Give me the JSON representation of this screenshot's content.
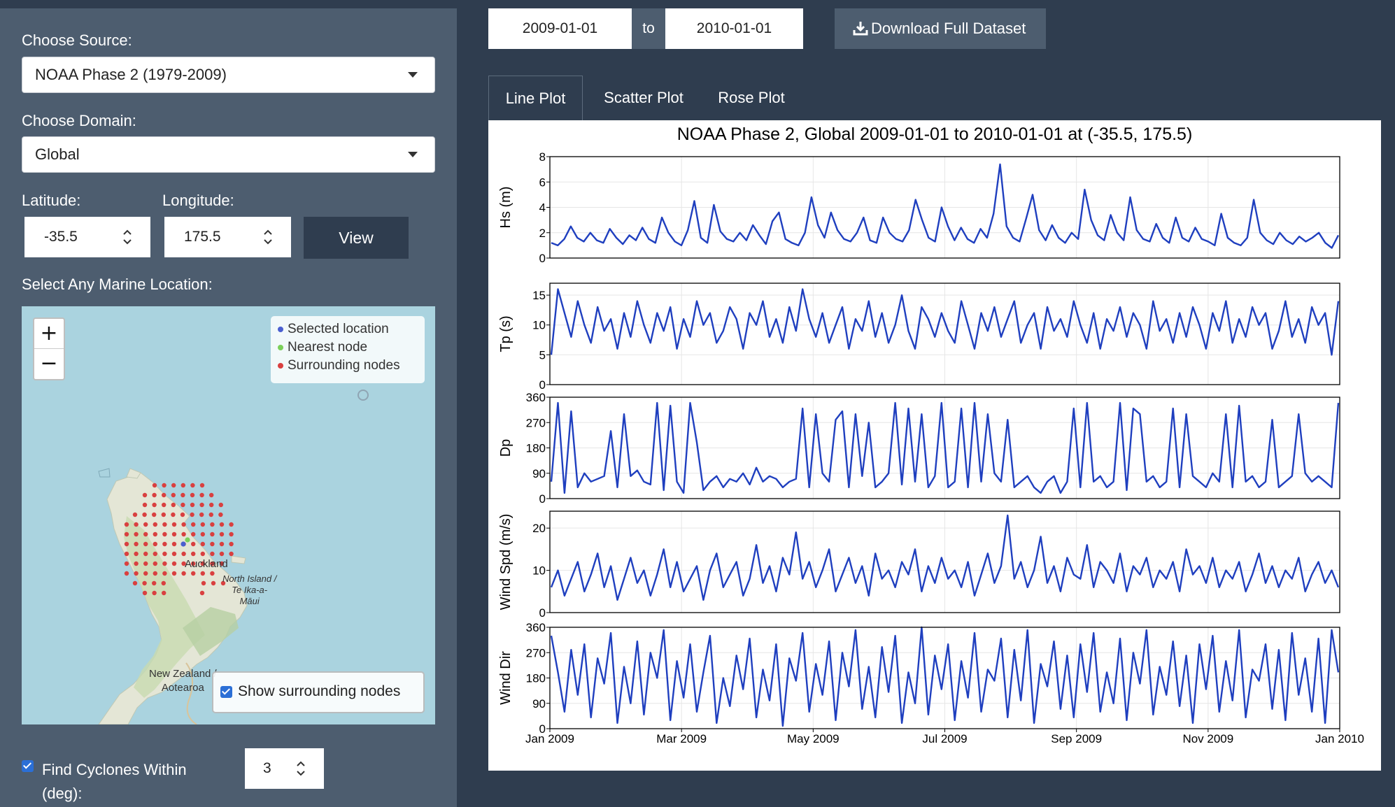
{
  "sidebar": {
    "source_label": "Choose Source:",
    "source_value": "NOAA Phase 2 (1979-2009)",
    "domain_label": "Choose Domain:",
    "domain_value": "Global",
    "latitude_label": "Latitude:",
    "latitude_value": "-35.5",
    "longitude_label": "Longitude:",
    "longitude_value": "175.5",
    "view_button": "View",
    "map_label": "Select Any Marine Location:",
    "cyclone_label_1": "Find Cyclones Within",
    "cyclone_label_2": "(deg):",
    "cyclone_value": "3"
  },
  "map": {
    "zoom_in": "+",
    "zoom_out": "−",
    "legend": [
      {
        "label": "Selected location",
        "color": "#4a5fd0"
      },
      {
        "label": "Nearest node",
        "color": "#7bd05a"
      },
      {
        "label": "Surrounding nodes",
        "color": "#d94040"
      }
    ],
    "place_auckland": "Auckland",
    "place_north_island_1": "North Island /",
    "place_north_island_2": "Te Ika-a-",
    "place_north_island_3": "Māui",
    "place_nz_1": "New Zealand /",
    "place_nz_2": "Aotearoa",
    "show_nodes_label": "Show surrounding nodes"
  },
  "topbar": {
    "start_date": "2009-01-01",
    "to_label": "to",
    "end_date": "2010-01-01",
    "download_label": "Download Full Dataset"
  },
  "tabs": [
    "Line Plot",
    "Scatter Plot",
    "Rose Plot"
  ],
  "chart_data": {
    "type": "line",
    "title": "NOAA Phase 2, Global 2009-01-01 to 2010-01-01 at (-35.5, 175.5)",
    "x_ticks": [
      "Jan 2009",
      "Mar 2009",
      "May 2009",
      "Jul 2009",
      "Sep 2009",
      "Nov 2009",
      "Jan 2010"
    ],
    "color": "#1f3fbf",
    "panels": [
      {
        "ylabel": "Hs (m)",
        "ylim": [
          0,
          8
        ],
        "yticks": [
          0,
          2,
          4,
          6,
          8
        ],
        "values": [
          1.2,
          1.0,
          1.5,
          2.5,
          1.6,
          1.3,
          2.0,
          1.4,
          1.2,
          2.3,
          1.6,
          1.1,
          1.8,
          1.4,
          2.4,
          1.5,
          1.2,
          3.2,
          2.0,
          1.3,
          1.0,
          2.2,
          4.5,
          1.6,
          1.2,
          4.2,
          2.1,
          1.5,
          1.3,
          2.0,
          1.4,
          2.6,
          1.8,
          1.1,
          2.9,
          3.6,
          1.5,
          1.2,
          1.0,
          2.0,
          4.8,
          2.6,
          1.6,
          3.6,
          2.2,
          1.5,
          1.3,
          2.0,
          3.2,
          1.4,
          1.2,
          3.2,
          2.0,
          1.5,
          1.3,
          2.2,
          4.6,
          3.0,
          1.6,
          1.3,
          4.0,
          2.5,
          1.4,
          2.4,
          1.5,
          1.2,
          2.3,
          1.6,
          3.5,
          7.4,
          2.5,
          1.6,
          1.3,
          3.1,
          5.0,
          2.2,
          1.4,
          2.6,
          1.6,
          1.2,
          2.0,
          1.5,
          5.4,
          3.0,
          1.8,
          1.4,
          3.4,
          2.0,
          1.4,
          4.8,
          2.2,
          1.5,
          1.3,
          2.7,
          1.6,
          1.2,
          3.2,
          1.6,
          1.3,
          2.4,
          1.5,
          1.3,
          1.0,
          3.5,
          1.6,
          1.2,
          1.0,
          1.6,
          4.6,
          2.0,
          1.4,
          1.1,
          2.0,
          1.4,
          1.1,
          1.7,
          1.3,
          1.6,
          2.0,
          1.2,
          0.8,
          1.8
        ]
      },
      {
        "ylabel": "Tp (s)",
        "ylim": [
          0,
          17
        ],
        "yticks": [
          0,
          5,
          10,
          15
        ],
        "values": [
          5,
          16,
          12,
          8,
          14,
          10,
          7,
          13,
          9,
          11,
          6,
          12,
          8,
          14,
          10,
          7,
          12,
          9,
          13,
          6,
          11,
          8,
          14,
          10,
          12,
          7,
          9,
          13,
          11,
          6,
          12,
          10,
          14,
          8,
          11,
          7,
          13,
          9,
          16,
          11,
          8,
          12,
          7,
          10,
          13,
          6,
          11,
          9,
          14,
          8,
          12,
          7,
          10,
          15,
          9,
          6,
          13,
          11,
          8,
          12,
          9,
          7,
          14,
          10,
          6,
          12,
          9,
          13,
          8,
          11,
          14,
          7,
          10,
          12,
          6,
          13,
          9,
          11,
          8,
          14,
          10,
          7,
          12,
          6,
          11,
          9,
          13,
          8,
          12,
          10,
          6,
          14,
          9,
          11,
          7,
          12,
          8,
          13,
          10,
          6,
          12,
          9,
          14,
          7,
          11,
          8,
          13,
          10,
          12,
          6,
          9,
          14,
          8,
          11,
          7,
          13,
          10,
          12,
          5,
          14
        ]
      },
      {
        "ylabel": "Dp",
        "ylim": [
          0,
          360
        ],
        "yticks": [
          0,
          90,
          180,
          270,
          360
        ],
        "values": [
          60,
          340,
          20,
          310,
          40,
          90,
          60,
          70,
          80,
          240,
          40,
          300,
          80,
          100,
          60,
          50,
          340,
          30,
          330,
          60,
          20,
          340,
          200,
          30,
          60,
          80,
          40,
          70,
          60,
          90,
          50,
          110,
          60,
          80,
          70,
          40,
          60,
          70,
          320,
          40,
          300,
          90,
          60,
          280,
          310,
          40,
          300,
          80,
          270,
          40,
          60,
          90,
          340,
          50,
          320,
          60,
          300,
          40,
          80,
          340,
          40,
          60,
          320,
          40,
          340,
          60,
          300,
          90,
          60,
          280,
          40,
          60,
          80,
          40,
          20,
          60,
          80,
          20,
          60,
          320,
          40,
          340,
          60,
          80,
          40,
          60,
          340,
          30,
          320,
          300,
          60,
          80,
          40,
          60,
          320,
          40,
          300,
          80,
          60,
          40,
          90,
          60,
          300,
          40,
          330,
          60,
          80,
          40,
          60,
          280,
          40,
          60,
          80,
          300,
          90,
          60,
          80,
          60,
          40,
          340
        ]
      },
      {
        "ylabel": "Wind Spd (m/s)",
        "ylim": [
          0,
          24
        ],
        "yticks": [
          0,
          10,
          20
        ],
        "values": [
          6,
          10,
          4,
          8,
          12,
          5,
          9,
          14,
          6,
          11,
          3,
          8,
          13,
          7,
          10,
          4,
          9,
          15,
          6,
          12,
          5,
          8,
          11,
          3,
          10,
          14,
          6,
          9,
          12,
          4,
          8,
          16,
          7,
          11,
          5,
          13,
          9,
          19,
          8,
          12,
          6,
          10,
          15,
          5,
          9,
          13,
          7,
          11,
          4,
          14,
          8,
          10,
          6,
          12,
          9,
          15,
          5,
          11,
          7,
          13,
          8,
          10,
          6,
          12,
          4,
          9,
          14,
          7,
          11,
          23,
          8,
          12,
          6,
          10,
          18,
          7,
          11,
          5,
          13,
          9,
          8,
          16,
          6,
          12,
          10,
          7,
          14,
          5,
          11,
          9,
          13,
          6,
          10,
          8,
          12,
          5,
          15,
          9,
          11,
          7,
          13,
          6,
          10,
          8,
          12,
          5,
          9,
          14,
          7,
          11,
          6,
          10,
          8,
          13,
          5,
          9,
          12,
          7,
          10,
          6
        ]
      },
      {
        "ylabel": "Wind Dir",
        "ylim": [
          0,
          360
        ],
        "yticks": [
          0,
          90,
          180,
          270,
          360
        ],
        "values": [
          330,
          200,
          60,
          280,
          120,
          300,
          40,
          250,
          160,
          340,
          20,
          220,
          90,
          310,
          50,
          270,
          180,
          350,
          30,
          240,
          110,
          300,
          60,
          200,
          330,
          20,
          180,
          80,
          260,
          140,
          320,
          40,
          210,
          100,
          300,
          10,
          250,
          170,
          340,
          60,
          230,
          120,
          310,
          30,
          270,
          150,
          350,
          70,
          220,
          40,
          290,
          130,
          330,
          20,
          200,
          90,
          360,
          50,
          260,
          140,
          300,
          30,
          240,
          110,
          340,
          60,
          210,
          170,
          320,
          40,
          280,
          100,
          350,
          20,
          230,
          150,
          310,
          70,
          260,
          40,
          300,
          130,
          340,
          60,
          200,
          90,
          320,
          30,
          270,
          160,
          350,
          50,
          220,
          120,
          310,
          80,
          260,
          20,
          300,
          140,
          330,
          60,
          240,
          100,
          350,
          40,
          210,
          170,
          300,
          70,
          280,
          30,
          340,
          120,
          250,
          60,
          320,
          20,
          350,
          200
        ]
      }
    ]
  }
}
